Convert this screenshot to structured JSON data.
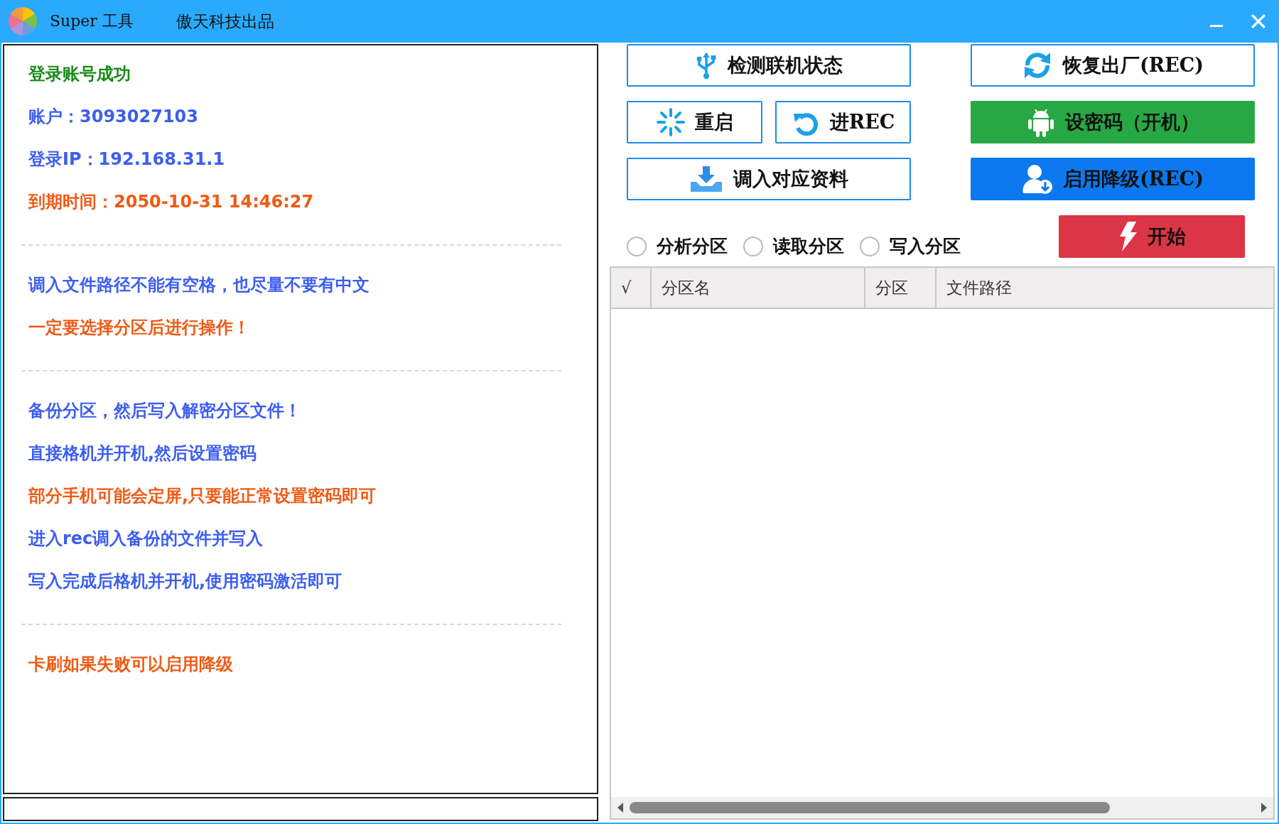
{
  "window": {
    "app_name": "Super 工具",
    "subtitle": "傲天科技出品"
  },
  "log_groups": [
    {
      "lines": [
        {
          "label": "登录账号成功",
          "color": "#178a17"
        },
        {
          "label": "账户：",
          "value": "3093027103",
          "color": "#3c5ef0"
        },
        {
          "label": "登录IP：",
          "value": "192.168.31.1",
          "color": "#3c5ef0"
        },
        {
          "label": "到期时间：",
          "value": "2050-10-31 14:46:27",
          "color": "#f05a14"
        }
      ]
    },
    {
      "lines": [
        {
          "label": "调入文件路径不能有空格，也尽量不要有中文",
          "color": "#3c5ef0"
        },
        {
          "label": "一定要选择分区后进行操作！",
          "color": "#f05a14"
        }
      ]
    },
    {
      "lines": [
        {
          "label": "备份分区，然后写入解密分区文件！",
          "color": "#3c5ef0"
        },
        {
          "label": "直接格机并开机,然后设置密码",
          "color": "#3c5ef0"
        },
        {
          "label": "部分手机可能会定屏,只要能正常设置密码即可",
          "color": "#f05a14"
        },
        {
          "label": "进入rec调入备份的文件并写入",
          "color": "#3c5ef0"
        },
        {
          "label": "写入完成后格机并开机,使用密码激活即可",
          "color": "#3c5ef0"
        }
      ]
    },
    {
      "lines": [
        {
          "label": "卡刷如果失败可以启用降级",
          "color": "#f05a14"
        }
      ]
    }
  ],
  "button_rows": [
    {
      "left": [
        {
          "label": "检测联机状态",
          "kind": "outline"
        }
      ],
      "right": {
        "label": "恢复出厂(REC)",
        "kind": "outline"
      }
    },
    {
      "left": [
        {
          "label": "重启",
          "kind": "outline"
        },
        {
          "label": "进REC",
          "kind": "outline"
        }
      ],
      "right": {
        "label": "设密码（开机）",
        "kind": "green"
      }
    },
    {
      "left": [
        {
          "label": "调入对应资料",
          "kind": "outline"
        }
      ],
      "right": {
        "label": "启用降级(REC)",
        "kind": "blue"
      }
    }
  ],
  "radios": [
    {
      "label": "分析分区",
      "selected": false
    },
    {
      "label": "读取分区",
      "selected": false
    },
    {
      "label": "写入分区",
      "selected": false
    }
  ],
  "start_button": {
    "label": "开始",
    "kind": "red"
  },
  "table": {
    "columns": [
      "√",
      "分区名",
      "分区",
      "文件路径"
    ]
  }
}
